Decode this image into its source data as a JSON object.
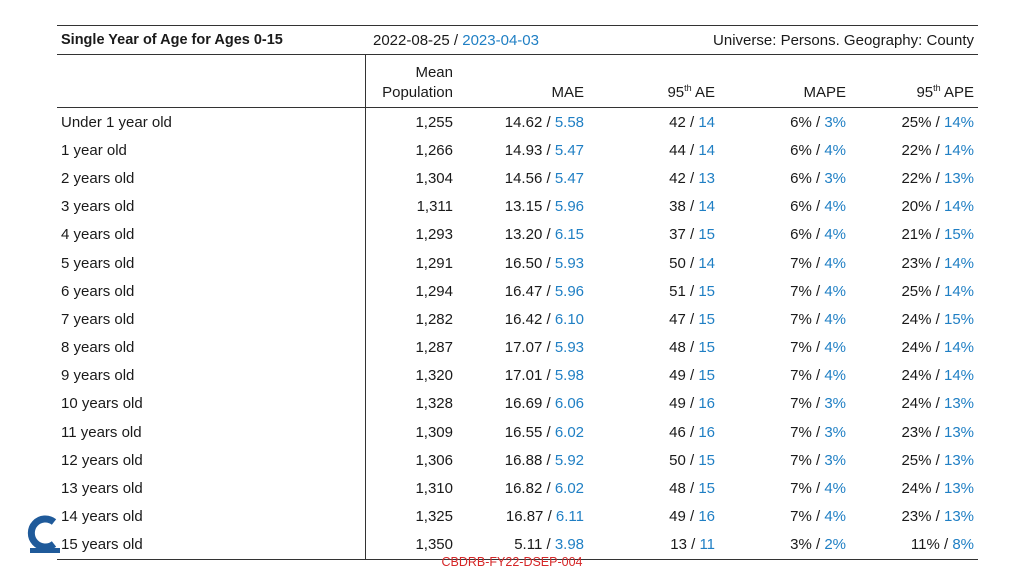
{
  "header": {
    "title": "Single Year of Age for Ages 0-15",
    "date_left": "2022-08-25",
    "date_sep": " / ",
    "date_right": "2023-04-03",
    "universe": "Universe: Persons. Geography: County"
  },
  "columns": {
    "mean_pop_line1": "Mean",
    "mean_pop_line2": "Population",
    "mae": "MAE",
    "ae_prefix": "95",
    "ae_sup": "th",
    "ae_suffix": " AE",
    "mape": "MAPE",
    "ape_prefix": "95",
    "ape_sup": "th",
    "ape_suffix": " APE"
  },
  "rows": [
    {
      "label": "Under 1 year old",
      "pop": "1,255",
      "mae_a": "14.62",
      "mae_b": "5.58",
      "ae_a": "42",
      "ae_b": "14",
      "mape_a": "6%",
      "mape_b": "3%",
      "ape_a": "25%",
      "ape_b": "14%"
    },
    {
      "label": "1 year old",
      "pop": "1,266",
      "mae_a": "14.93",
      "mae_b": "5.47",
      "ae_a": "44",
      "ae_b": "14",
      "mape_a": "6%",
      "mape_b": "4%",
      "ape_a": "22%",
      "ape_b": "14%"
    },
    {
      "label": "2 years old",
      "pop": "1,304",
      "mae_a": "14.56",
      "mae_b": "5.47",
      "ae_a": "42",
      "ae_b": "13",
      "mape_a": "6%",
      "mape_b": "3%",
      "ape_a": "22%",
      "ape_b": "13%"
    },
    {
      "label": "3 years old",
      "pop": "1,311",
      "mae_a": "13.15",
      "mae_b": "5.96",
      "ae_a": "38",
      "ae_b": "14",
      "mape_a": "6%",
      "mape_b": "4%",
      "ape_a": "20%",
      "ape_b": "14%"
    },
    {
      "label": "4 years old",
      "pop": "1,293",
      "mae_a": "13.20",
      "mae_b": "6.15",
      "ae_a": "37",
      "ae_b": "15",
      "mape_a": "6%",
      "mape_b": "4%",
      "ape_a": "21%",
      "ape_b": "15%"
    },
    {
      "label": "5 years old",
      "pop": "1,291",
      "mae_a": "16.50",
      "mae_b": "5.93",
      "ae_a": "50",
      "ae_b": "14",
      "mape_a": "7%",
      "mape_b": "4%",
      "ape_a": "23%",
      "ape_b": "14%"
    },
    {
      "label": "6 years old",
      "pop": "1,294",
      "mae_a": "16.47",
      "mae_b": "5.96",
      "ae_a": "51",
      "ae_b": "15",
      "mape_a": "7%",
      "mape_b": "4%",
      "ape_a": "25%",
      "ape_b": "14%"
    },
    {
      "label": "7 years old",
      "pop": "1,282",
      "mae_a": "16.42",
      "mae_b": "6.10",
      "ae_a": "47",
      "ae_b": "15",
      "mape_a": "7%",
      "mape_b": "4%",
      "ape_a": "24%",
      "ape_b": "15%"
    },
    {
      "label": "8 years old",
      "pop": "1,287",
      "mae_a": "17.07",
      "mae_b": "5.93",
      "ae_a": "48",
      "ae_b": "15",
      "mape_a": "7%",
      "mape_b": "4%",
      "ape_a": "24%",
      "ape_b": "14%"
    },
    {
      "label": "9 years old",
      "pop": "1,320",
      "mae_a": "17.01",
      "mae_b": "5.98",
      "ae_a": "49",
      "ae_b": "15",
      "mape_a": "7%",
      "mape_b": "4%",
      "ape_a": "24%",
      "ape_b": "14%"
    },
    {
      "label": "10 years old",
      "pop": "1,328",
      "mae_a": "16.69",
      "mae_b": "6.06",
      "ae_a": "49",
      "ae_b": "16",
      "mape_a": "7%",
      "mape_b": "3%",
      "ape_a": "24%",
      "ape_b": "13%"
    },
    {
      "label": "11 years old",
      "pop": "1,309",
      "mae_a": "16.55",
      "mae_b": "6.02",
      "ae_a": "46",
      "ae_b": "16",
      "mape_a": "7%",
      "mape_b": "3%",
      "ape_a": "23%",
      "ape_b": "13%"
    },
    {
      "label": "12 years old",
      "pop": "1,306",
      "mae_a": "16.88",
      "mae_b": "5.92",
      "ae_a": "50",
      "ae_b": "15",
      "mape_a": "7%",
      "mape_b": "3%",
      "ape_a": "25%",
      "ape_b": "13%"
    },
    {
      "label": "13 years old",
      "pop": "1,310",
      "mae_a": "16.82",
      "mae_b": "6.02",
      "ae_a": "48",
      "ae_b": "15",
      "mape_a": "7%",
      "mape_b": "4%",
      "ape_a": "24%",
      "ape_b": "13%"
    },
    {
      "label": "14 years old",
      "pop": "1,325",
      "mae_a": "16.87",
      "mae_b": "6.11",
      "ae_a": "49",
      "ae_b": "16",
      "mape_a": "7%",
      "mape_b": "4%",
      "ape_a": "23%",
      "ape_b": "13%"
    },
    {
      "label": "15 years old",
      "pop": "1,350",
      "mae_a": "5.11",
      "mae_b": "3.98",
      "ae_a": "13",
      "ae_b": "11",
      "mape_a": "3%",
      "mape_b": "2%",
      "ape_a": "11%",
      "ape_b": "8%"
    }
  ],
  "separator": " / ",
  "footer": "CBDRB-FY22-DSEP-004",
  "colors": {
    "accent_blue": "#1f7fc4",
    "footer_red": "#d62728",
    "rule": "#333333"
  },
  "icons": {
    "logo": "census-logo-partial"
  }
}
